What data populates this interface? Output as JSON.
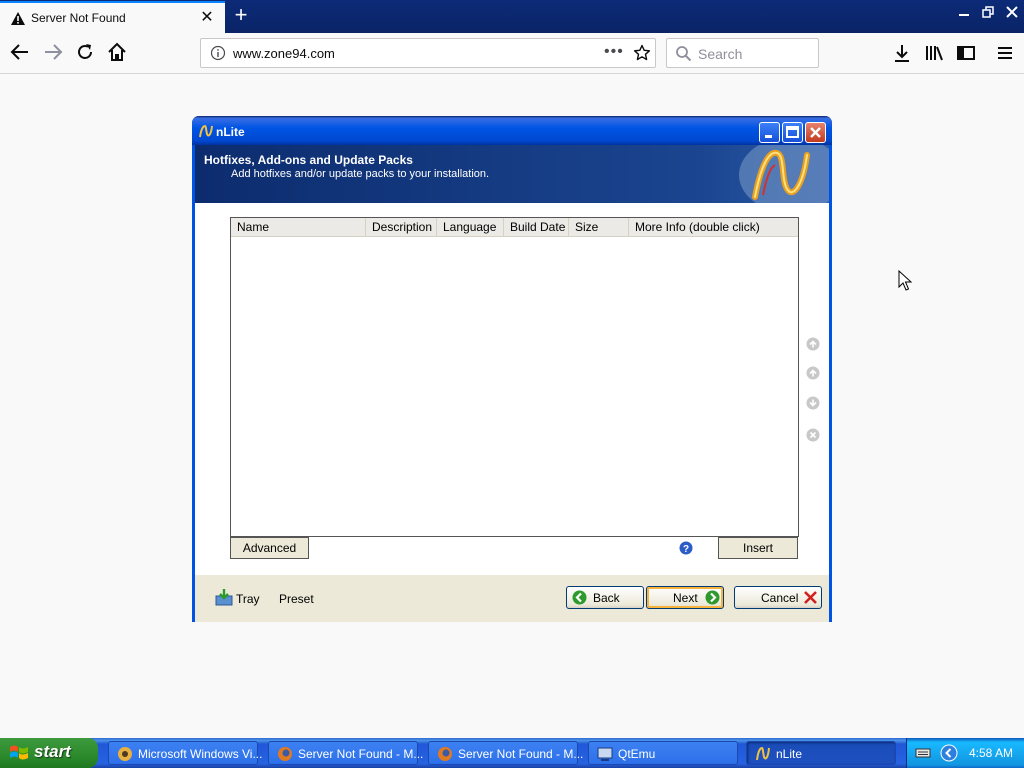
{
  "browser": {
    "tab_title": "Server Not Found",
    "url": "www.zone94.com",
    "search_placeholder": "Search"
  },
  "dialog": {
    "title": "nLite",
    "header_title": "Hotfixes, Add-ons and Update Packs",
    "header_subtitle": "Add hotfixes and/or update packs to your installation.",
    "columns": [
      "Name",
      "Description",
      "Language",
      "Build Date",
      "Size",
      "More Info (double click)"
    ],
    "rows": [],
    "advanced_label": "Advanced",
    "insert_label": "Insert",
    "tray_label": "Tray",
    "preset_label": "Preset",
    "back_label": "Back",
    "next_label": "Next",
    "cancel_label": "Cancel"
  },
  "taskbar": {
    "start_label": "start",
    "items": [
      {
        "label": "Microsoft Windows Vi...",
        "icon": "media-icon"
      },
      {
        "label": "Server Not Found - M...",
        "icon": "firefox-icon"
      },
      {
        "label": "Server Not Found - M...",
        "icon": "firefox-icon"
      },
      {
        "label": "QtEmu",
        "icon": "qtemu-icon"
      },
      {
        "label": "nLite",
        "icon": "nlite-icon",
        "active": true
      }
    ],
    "clock": "4:58 AM"
  },
  "colors": {
    "xp_blue": "#0054e3",
    "header_blue": "#1a3d82",
    "start_green": "#2f8d2f"
  }
}
